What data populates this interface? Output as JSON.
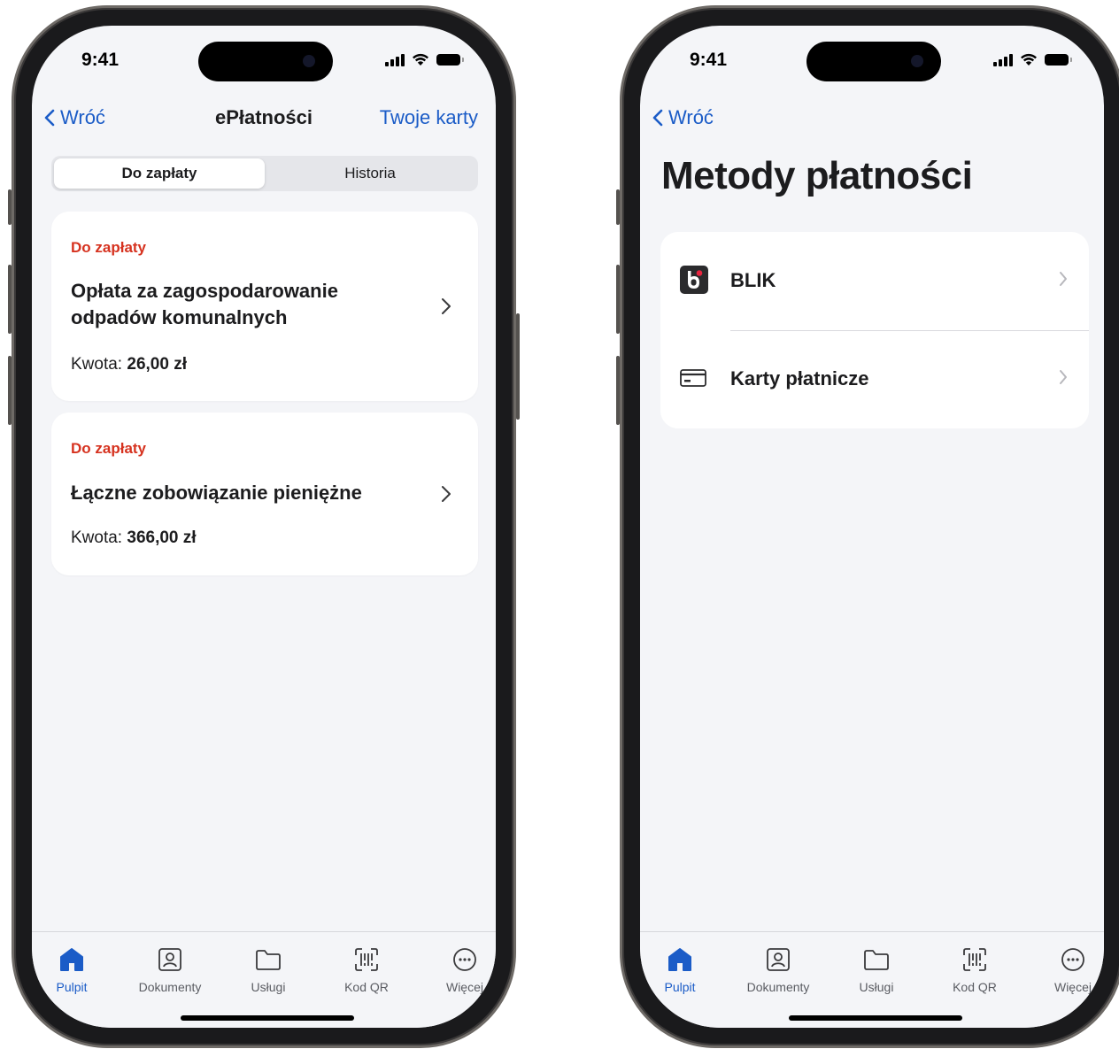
{
  "status_bar": {
    "time": "9:41"
  },
  "screen_left": {
    "nav": {
      "back_label": "Wróć",
      "title": "ePłatności",
      "right_action": "Twoje karty"
    },
    "segments": {
      "active": "Do zapłaty",
      "inactive": "Historia"
    },
    "payments": [
      {
        "status": "Do zapłaty",
        "title": "Opłata za zagospodarowanie odpadów komunalnych",
        "amount_label": "Kwota:",
        "amount": "26,00 zł"
      },
      {
        "status": "Do zapłaty",
        "title": "Łączne zobowiązanie pieniężne",
        "amount_label": "Kwota:",
        "amount": "366,00 zł"
      }
    ]
  },
  "screen_right": {
    "nav": {
      "back_label": "Wróć"
    },
    "title": "Metody płatności",
    "methods": [
      {
        "label": "BLIK",
        "icon": "blik-logo"
      },
      {
        "label": "Karty płatnicze",
        "icon": "card-icon"
      }
    ]
  },
  "tabbar": {
    "items": [
      {
        "label": "Pulpit",
        "icon": "home-icon",
        "active": true
      },
      {
        "label": "Dokumenty",
        "icon": "id-card-icon"
      },
      {
        "label": "Usługi",
        "icon": "folder-icon"
      },
      {
        "label": "Kod QR",
        "icon": "qr-scan-icon"
      },
      {
        "label": "Więcej",
        "icon": "more-icon"
      }
    ]
  },
  "colors": {
    "accent": "#1b5cc7",
    "due_status": "#d6321f",
    "background": "#f4f5f8"
  }
}
